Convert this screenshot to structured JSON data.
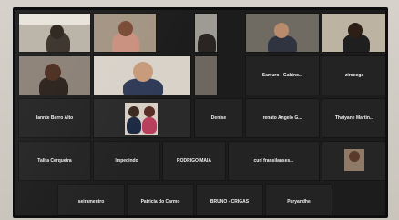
{
  "participants": {
    "p01": {
      "name": "",
      "sub": ""
    },
    "p02": {
      "name": "",
      "sub": ""
    },
    "p03": {
      "name": "",
      "sub": ""
    },
    "p04": {
      "name": "",
      "sub": ""
    },
    "p05": {
      "name": "",
      "sub": ""
    },
    "p06": {
      "name": "",
      "sub": ""
    },
    "p07": {
      "name": "",
      "sub": ""
    },
    "p08": {
      "name": "",
      "sub": ""
    },
    "p09": {
      "name": "Samuro - Gabino...",
      "sub": ""
    },
    "p10": {
      "name": "ziroxega",
      "sub": ""
    },
    "p11": {
      "name": "Iannte Barro Alto",
      "sub": ""
    },
    "p12": {
      "name": "",
      "sub": ""
    },
    "p13": {
      "name": "Denise",
      "sub": ""
    },
    "p14": {
      "name": "renato Angelo G...",
      "sub": ""
    },
    "p15": {
      "name": "Thaiyane Martin...",
      "sub": ""
    },
    "p16": {
      "name": "Talita Cerqueira",
      "sub": ""
    },
    "p17": {
      "name": "Impedindo",
      "sub": ""
    },
    "p18": {
      "name": "RODRIGO MAIA",
      "sub": ""
    },
    "p19": {
      "name": "curl fransilanses...",
      "sub": ""
    },
    "p20": {
      "name": "",
      "sub": ""
    },
    "p21": {
      "name": "seiramentro",
      "sub": ""
    },
    "p22": {
      "name": "Patricia do Carmo",
      "sub": ""
    },
    "p23": {
      "name": "BRUNO - CRIGAS",
      "sub": ""
    },
    "p24": {
      "name": "Paryandhe",
      "sub": ""
    }
  },
  "colors": {
    "tile_bg": "#222222",
    "name_text": "#f2f2f2",
    "screen_bg": "#1c1c1c"
  }
}
